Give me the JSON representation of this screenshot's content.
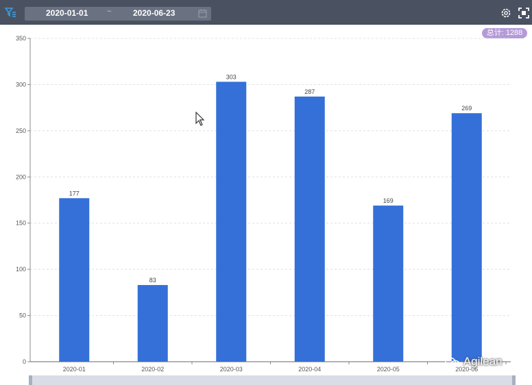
{
  "toolbar": {
    "start_date": "2020-01-01",
    "separator": "~",
    "end_date": "2020-06-23",
    "icons": {
      "filter": "filter-icon",
      "calendar": "calendar-icon",
      "settings": "gear-icon",
      "fullscreen": "fullscreen-icon"
    }
  },
  "summary_badge": "总计: 1288",
  "watermark": "Agilean",
  "colors": {
    "bar": "#3470d8",
    "toolbar": "#4a5262",
    "badge": "#b59ad8",
    "filter_icon": "#3aa0e6"
  },
  "chart_data": {
    "type": "bar",
    "title": "",
    "xlabel": "",
    "ylabel": "",
    "categories": [
      "2020-01",
      "2020-02",
      "2020-03",
      "2020-04",
      "2020-05",
      "2020-06"
    ],
    "values": [
      177,
      83,
      303,
      287,
      169,
      269
    ],
    "ylim": [
      0,
      350
    ],
    "yticks": [
      0,
      50,
      100,
      150,
      200,
      250,
      300,
      350
    ],
    "grid": true,
    "data_labels": true,
    "legend": "none"
  }
}
